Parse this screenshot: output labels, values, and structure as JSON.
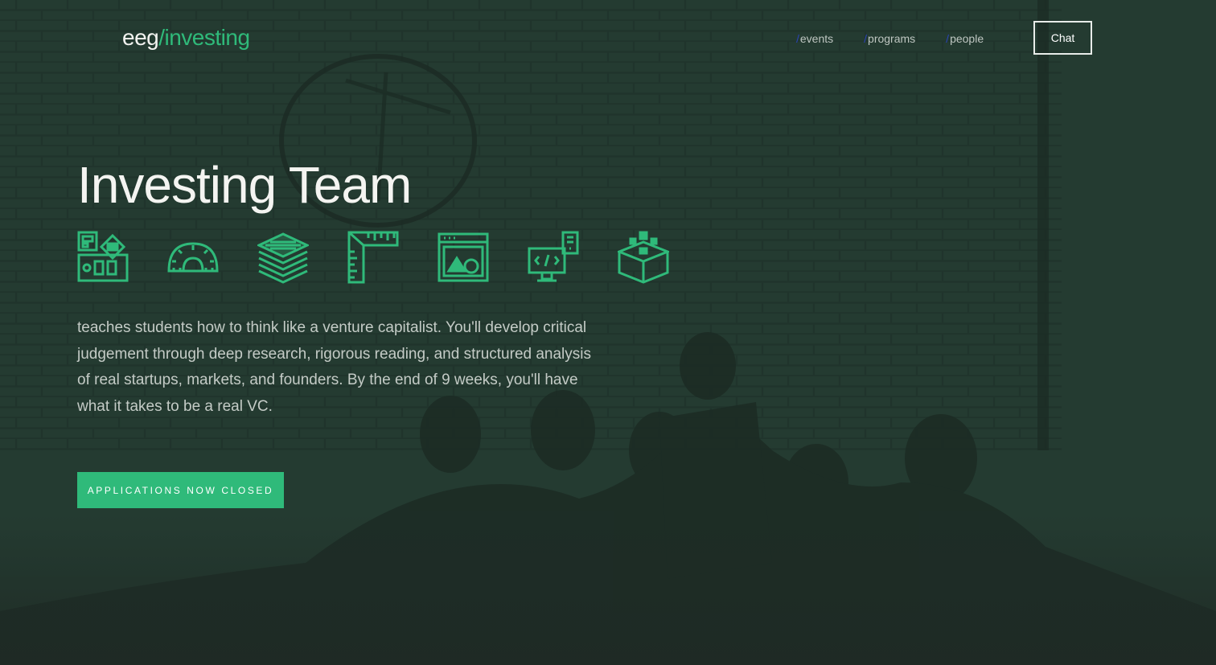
{
  "logo": {
    "prefix": "eeg",
    "slash": "/",
    "suffix": "investing"
  },
  "nav": {
    "links": [
      {
        "prefix": "/",
        "label": "events"
      },
      {
        "prefix": "/",
        "label": "programs"
      },
      {
        "prefix": "/",
        "label": "people"
      }
    ],
    "chat_label": "Chat"
  },
  "hero": {
    "title": "Investing Team",
    "description": "teaches students how to think like a venture capitalist. You'll develop critical judgement through deep research, rigorous reading, and structured analysis of real startups, markets, and founders. By the end of 9 weeks, you'll have what it takes to be a real VC.",
    "cta_label": "APPLICATIONS NOW CLOSED",
    "icons": [
      "dashboard-icon",
      "protractor-icon",
      "stack-layers-icon",
      "ruler-icon",
      "browser-window-icon",
      "code-monitor-icon",
      "cube-icon"
    ]
  },
  "colors": {
    "background": "#243b31",
    "accent": "#2fba7a",
    "text": "#f4f4f1",
    "muted": "#c4cbc6",
    "nav_slash": "#2a44b8"
  }
}
